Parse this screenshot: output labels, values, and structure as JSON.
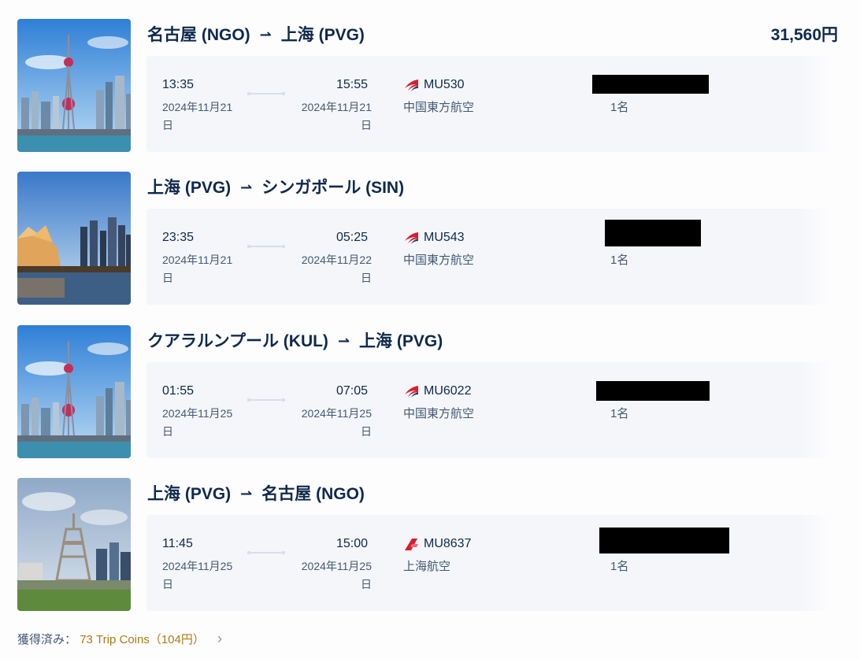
{
  "total_price": "31,560円",
  "segments": [
    {
      "image": "shanghai-skyline",
      "origin": "名古屋 (NGO)",
      "destination": "上海 (PVG)",
      "arrow": "⇀",
      "dep_time": "13:35",
      "dep_date": "2024年11月21日",
      "arr_time": "15:55",
      "arr_date": "2024年11月21日",
      "flight_no": "MU530",
      "airline": "中国東方航空",
      "airline_logo": "china-eastern-logo",
      "passengers": "1名"
    },
    {
      "image": "singapore-skyline",
      "origin": "上海 (PVG)",
      "destination": "シンガポール (SIN)",
      "arrow": "⇀",
      "dep_time": "23:35",
      "dep_date": "2024年11月21日",
      "arr_time": "05:25",
      "arr_date": "2024年11月22日",
      "flight_no": "MU543",
      "airline": "中国東方航空",
      "airline_logo": "china-eastern-logo",
      "passengers": "1名"
    },
    {
      "image": "shanghai-skyline",
      "origin": "クアラルンプール (KUL)",
      "destination": "上海 (PVG)",
      "arrow": "⇀",
      "dep_time": "01:55",
      "dep_date": "2024年11月25日",
      "arr_time": "07:05",
      "arr_date": "2024年11月25日",
      "flight_no": "MU6022",
      "airline": "中国東方航空",
      "airline_logo": "china-eastern-logo",
      "passengers": "1名"
    },
    {
      "image": "nagoya-tv-tower",
      "origin": "上海 (PVG)",
      "destination": "名古屋 (NGO)",
      "arrow": "⇀",
      "dep_time": "11:45",
      "dep_date": "2024年11月25日",
      "arr_time": "15:00",
      "arr_date": "2024年11月25日",
      "flight_no": "MU8637",
      "airline": "上海航空",
      "airline_logo": "shanghai-airlines-logo",
      "passengers": "1名"
    }
  ],
  "coins": {
    "label": "獲得済み：",
    "value": "73 Trip Coins（104円）",
    "chevron": "›"
  },
  "colors": {
    "navy": "#0f294d",
    "secondary": "#455873",
    "panel": "#f4f6f9",
    "gold": "#b07a16",
    "china_eastern_red": "#d81e2c"
  }
}
